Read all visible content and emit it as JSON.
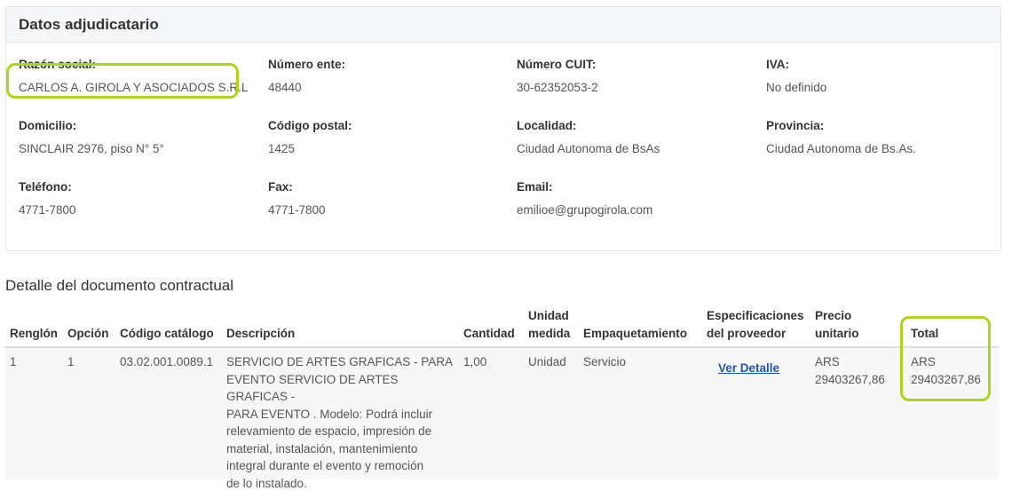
{
  "panel": {
    "title": "Datos adjudicatario",
    "fields": {
      "razon_social": {
        "label": "Razón social:",
        "value": "CARLOS A. GIROLA Y ASOCIADOS S.R.L"
      },
      "numero_ente": {
        "label": "Número ente:",
        "value": "48440"
      },
      "numero_cuit": {
        "label": "Número CUIT:",
        "value": "30-62352053-2"
      },
      "iva": {
        "label": "IVA:",
        "value": "No definido"
      },
      "domicilio": {
        "label": "Domicilio:",
        "value": "SINCLAIR 2976, piso N° 5°"
      },
      "codigo_postal": {
        "label": "Código postal:",
        "value": "1425"
      },
      "localidad": {
        "label": "Localidad:",
        "value": "Ciudad Autonoma de BsAs"
      },
      "provincia": {
        "label": "Provincia:",
        "value": "Ciudad Autonoma de Bs.As."
      },
      "telefono": {
        "label": "Teléfono:",
        "value": "4771-7800"
      },
      "fax": {
        "label": "Fax:",
        "value": "4771-7800"
      },
      "email": {
        "label": "Email:",
        "value": "emilioe@grupogirola.com"
      }
    }
  },
  "detalle": {
    "title": "Detalle del documento contractual",
    "columns": {
      "renglon": "Renglón",
      "opcion": "Opción",
      "codigo": "Código catálogo",
      "descripcion": "Descripción",
      "cantidad": "Cantidad",
      "unidad_1": "Unidad",
      "unidad_2": "medida",
      "empaquetamiento": "Empaquetamiento",
      "espec_1": "Especificaciones",
      "espec_2": "del proveedor",
      "precio_1": "Precio",
      "precio_2": "unitario",
      "total": "Total"
    },
    "rows": [
      {
        "renglon": "1",
        "opcion": "1",
        "codigo": "03.02.001.0089.1",
        "descripcion_lines": [
          "SERVICIO DE ARTES GRAFICAS - PARA",
          "EVENTO SERVICIO DE ARTES GRAFICAS -",
          "PARA EVENTO . Modelo: Podrá incluir",
          "relevamiento de espacio, impresión de",
          "material, instalación, mantenimiento",
          "integral durante el evento y remoción",
          "de lo instalado."
        ],
        "cantidad": "1,00",
        "unidad": "Unidad",
        "empaquetamiento": "Servicio",
        "espec_link": "Ver Detalle",
        "precio_currency": "ARS",
        "precio_value": "29403267,86",
        "total_currency": "ARS",
        "total_value": "29403267,86"
      }
    ]
  },
  "colors": {
    "highlight": "#a9d61a",
    "link": "#2255aa"
  }
}
